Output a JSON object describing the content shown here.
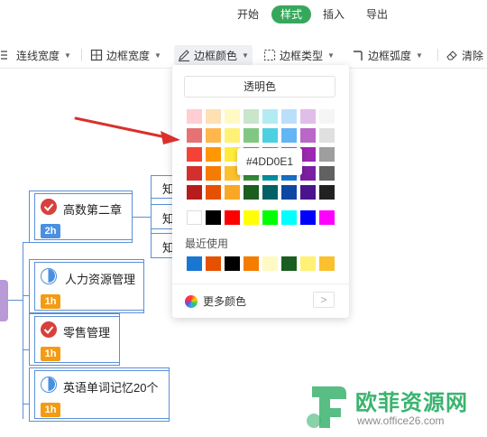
{
  "tabs": [
    "开始",
    "样式",
    "插入",
    "导出"
  ],
  "toolbar": {
    "line_width": "连线宽度",
    "border_width": "边框宽度",
    "border_color": "边框颜色",
    "border_type": "边框类型",
    "border_radius": "边框弧度",
    "clear": "清除"
  },
  "picker": {
    "transparent": "透明色",
    "recent_label": "最近使用",
    "more_colors": "更多颜色",
    "tooltip": "#4DD0E1",
    "grid": [
      [
        "#ffcdd2",
        "#ffe0b2",
        "#fff9c4",
        "#c8e6c9",
        "#b2ebf2",
        "#bbdefb",
        "#e1bee7",
        "#f5f5f5"
      ],
      [
        "#e57373",
        "#ffb74d",
        "#fff176",
        "#81c784",
        "#4dd0e1",
        "#64b5f6",
        "#ba68c8",
        "#e0e0e0"
      ],
      [
        "#f44336",
        "#ff9800",
        "#ffeb3b",
        "#4caf50",
        "#00bcd4",
        "#2196f3",
        "#9c27b0",
        "#9e9e9e"
      ],
      [
        "#d32f2f",
        "#f57c00",
        "#fbc02d",
        "#388e3c",
        "#0097a7",
        "#1976d2",
        "#7b1fa2",
        "#616161"
      ],
      [
        "#b71c1c",
        "#e65100",
        "#f9a825",
        "#1b5e20",
        "#006064",
        "#0d47a1",
        "#4a148c",
        "#212121"
      ]
    ],
    "basic": [
      "#ffffff",
      "#000000",
      "#ff0000",
      "#ffff00",
      "#00ff00",
      "#00ffff",
      "#0000ff",
      "#ff00ff"
    ],
    "recent": [
      "#1976d2",
      "#e65100",
      "#000000",
      "#f57c00",
      "#fff9c4",
      "#1b5e20",
      "#fff176",
      "#fbc02d"
    ]
  },
  "nodes": [
    {
      "title": "高数第二章",
      "chip": "2h"
    },
    {
      "title": "人力资源管理",
      "chip": "1h"
    },
    {
      "title": "零售管理",
      "chip": "1h"
    },
    {
      "title": "英语单词记忆20个",
      "chip": "1h"
    }
  ],
  "sub_nodes": [
    "知",
    "知",
    "知"
  ],
  "watermark": {
    "name": "欧菲资源网",
    "url": "www.office26.com"
  },
  "colors": {
    "accent": "#36a85c",
    "node_border": "#5b8fd6",
    "arrow": "#d9302c"
  }
}
